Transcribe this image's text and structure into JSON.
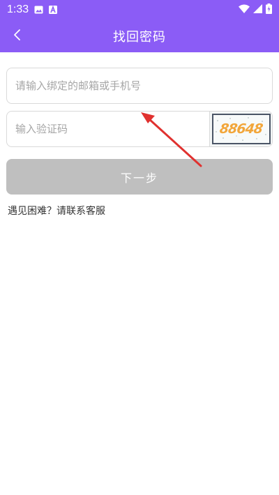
{
  "status_bar": {
    "time": "1:33",
    "icons": [
      "image-icon",
      "text-a-icon",
      "wifi-icon",
      "signal-icon",
      "battery-charging-icon"
    ]
  },
  "header": {
    "title": "找回密码",
    "back_icon": "chevron-left-icon"
  },
  "form": {
    "account_placeholder": "请输入绑定的邮箱或手机号",
    "account_value": "",
    "code_placeholder": "输入验证码",
    "code_value": "",
    "captcha_text": "88648",
    "next_label": "下一步"
  },
  "help_text": "遇见困难？请联系客服",
  "colors": {
    "primary": "#8b5cf6",
    "button_disabled": "#bfbfbf",
    "annotation_arrow": "#e0312f",
    "captcha_digits": "#f2a63a"
  }
}
